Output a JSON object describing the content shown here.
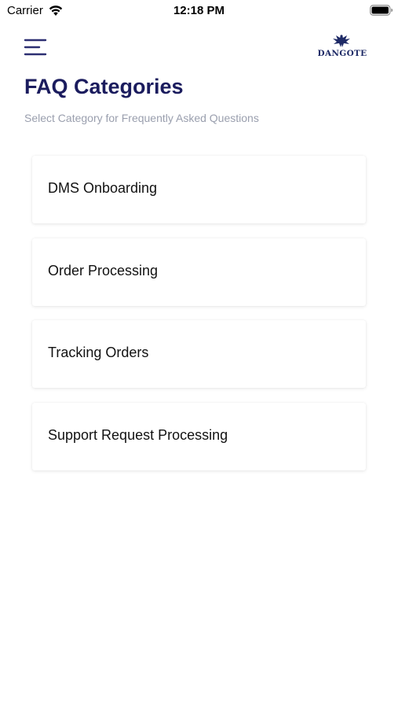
{
  "status_bar": {
    "carrier": "Carrier",
    "time": "12:18 PM"
  },
  "header": {
    "menu_icon": "hamburger-menu-icon",
    "logo_text": "DANGOTE"
  },
  "page": {
    "title": "FAQ Categories",
    "subtitle": "Select Category for Frequently Asked Questions"
  },
  "categories": [
    {
      "label": "DMS Onboarding"
    },
    {
      "label": "Order Processing"
    },
    {
      "label": "Tracking Orders"
    },
    {
      "label": "Support Request Processing"
    }
  ],
  "colors": {
    "title": "#1b1c5e",
    "subtitle": "#9a9fae",
    "menu_icon": "#2c2f72",
    "logo": "#1e2a66"
  }
}
